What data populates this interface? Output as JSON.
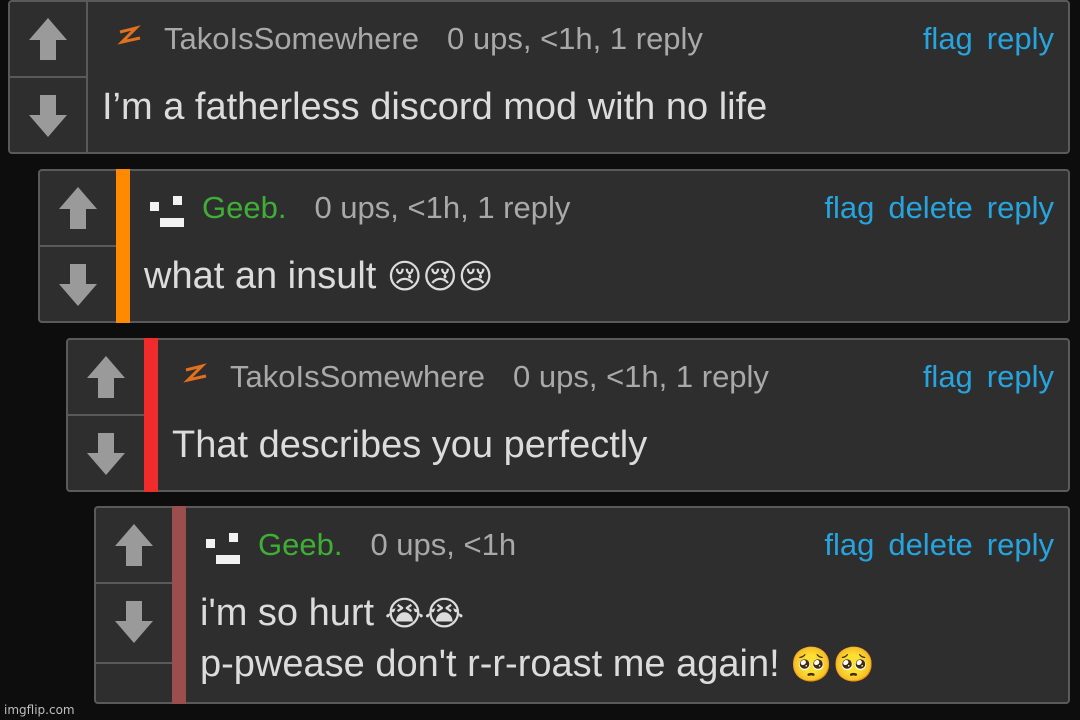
{
  "comments": [
    {
      "user": "TakoIsSomewhere",
      "meta": "0 ups, <1h, 1 reply",
      "actions": [
        "flag",
        "reply"
      ],
      "lines": [
        "I’m a fatherless discord mod with no life"
      ],
      "emojis": [
        ""
      ],
      "user_color": "#a9a9a9",
      "depth_color": null,
      "icon": "lightning-icon"
    },
    {
      "user": "Geeb.",
      "meta": "0 ups, <1h, 1 reply",
      "actions": [
        "flag",
        "delete",
        "reply"
      ],
      "lines": [
        "what an insult"
      ],
      "emojis": [
        "😢😢😢"
      ],
      "user_color": "#3fae36",
      "depth_color": "#ff8a00",
      "icon": "glitch-logo-icon"
    },
    {
      "user": "TakoIsSomewhere",
      "meta": "0 ups, <1h, 1 reply",
      "actions": [
        "flag",
        "reply"
      ],
      "lines": [
        "That describes you perfectly"
      ],
      "emojis": [
        ""
      ],
      "user_color": "#a9a9a9",
      "depth_color": "#f02b2b",
      "icon": "lightning-icon"
    },
    {
      "user": "Geeb.",
      "meta": "0 ups, <1h",
      "actions": [
        "flag",
        "delete",
        "reply"
      ],
      "lines": [
        "i'm so hurt",
        "p-pwease don't r-r-roast me again!"
      ],
      "emojis": [
        "😭😭",
        "🥺🥺"
      ],
      "user_color": "#3fae36",
      "depth_color": "#9b4e4e",
      "icon": "glitch-logo-icon"
    }
  ],
  "watermark": "imgflip.com"
}
